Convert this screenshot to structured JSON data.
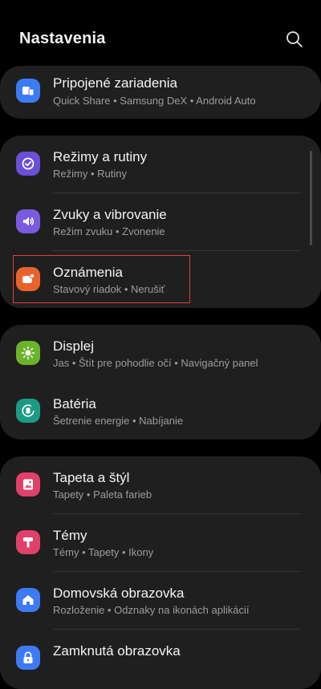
{
  "header": {
    "title": "Nastavenia",
    "search_icon": "search-icon"
  },
  "groups": [
    {
      "items": [
        {
          "label": "Pripojené zariadenia",
          "sub": "Quick Share  •  Samsung DeX  •  Android Auto",
          "icon": "connected-devices-icon",
          "color": "#3d7bf4"
        }
      ]
    },
    {
      "items": [
        {
          "label": "Režimy a rutiny",
          "sub": "Režimy  •  Rutiny",
          "icon": "modes-routines-icon",
          "color": "#6a4fd8"
        },
        {
          "label": "Zvuky a vibrovanie",
          "sub": "Režim zvuku  •  Zvonenie",
          "icon": "speaker-icon",
          "color": "#7b5ae0"
        },
        {
          "label": "Oznámenia",
          "sub": "Stavový riadok  •  Nerušiť",
          "icon": "notification-icon",
          "color": "#e8622c"
        }
      ]
    },
    {
      "items": [
        {
          "label": "Displej",
          "sub": "Jas  •  Štít pre pohodlie očí  •  Navigačný panel",
          "icon": "brightness-icon",
          "color": "#6cb32b"
        },
        {
          "label": "Batéria",
          "sub": "Šetrenie energie  •  Nabíjanie",
          "icon": "battery-icon",
          "color": "#1d9a84"
        }
      ]
    },
    {
      "items": [
        {
          "label": "Tapeta a štýl",
          "sub": "Tapety  •  Paleta farieb",
          "icon": "wallpaper-icon",
          "color": "#e0416a"
        },
        {
          "label": "Témy",
          "sub": "Témy  •  Tapety  •  Ikony",
          "icon": "themes-icon",
          "color": "#e0416a"
        },
        {
          "label": "Domovská obrazovka",
          "sub": "Rozloženie  •  Odznaky na ikonách aplikácií",
          "icon": "home-icon",
          "color": "#3d7bf4"
        },
        {
          "label": "Zamknutá obrazovka",
          "sub": "",
          "icon": "lock-icon",
          "color": "#3d7bf4"
        }
      ]
    }
  ]
}
